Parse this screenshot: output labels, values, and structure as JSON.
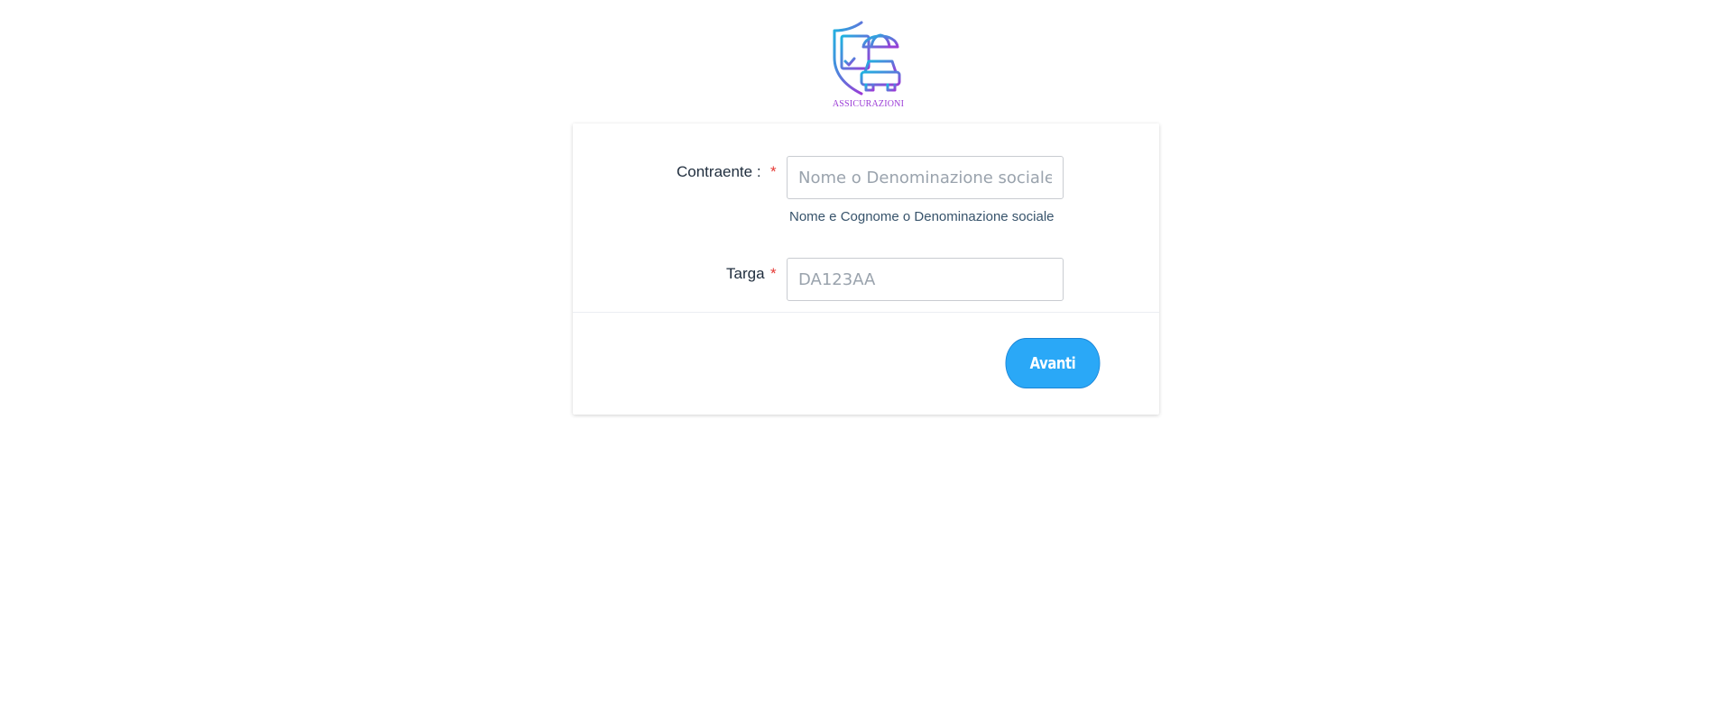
{
  "logo": {
    "brand_text": "ASSICURAZIONI",
    "icon": "insurance-shield-car-umbrella-icon",
    "colors": {
      "from": "#1cb5e0",
      "to": "#9b3bd6"
    }
  },
  "form": {
    "contraente": {
      "label": "Contraente :",
      "required_mark": "*",
      "value": "",
      "placeholder": "Nome o Denominazione sociale",
      "hint": "Nome e Cognome o Denominazione sociale"
    },
    "targa": {
      "label": "Targa",
      "required_mark": "*",
      "value": "",
      "placeholder": "DA123AA"
    },
    "submit_label": "Avanti"
  },
  "colors": {
    "primary_button": "#2aa8f7",
    "required": "#e53935"
  }
}
